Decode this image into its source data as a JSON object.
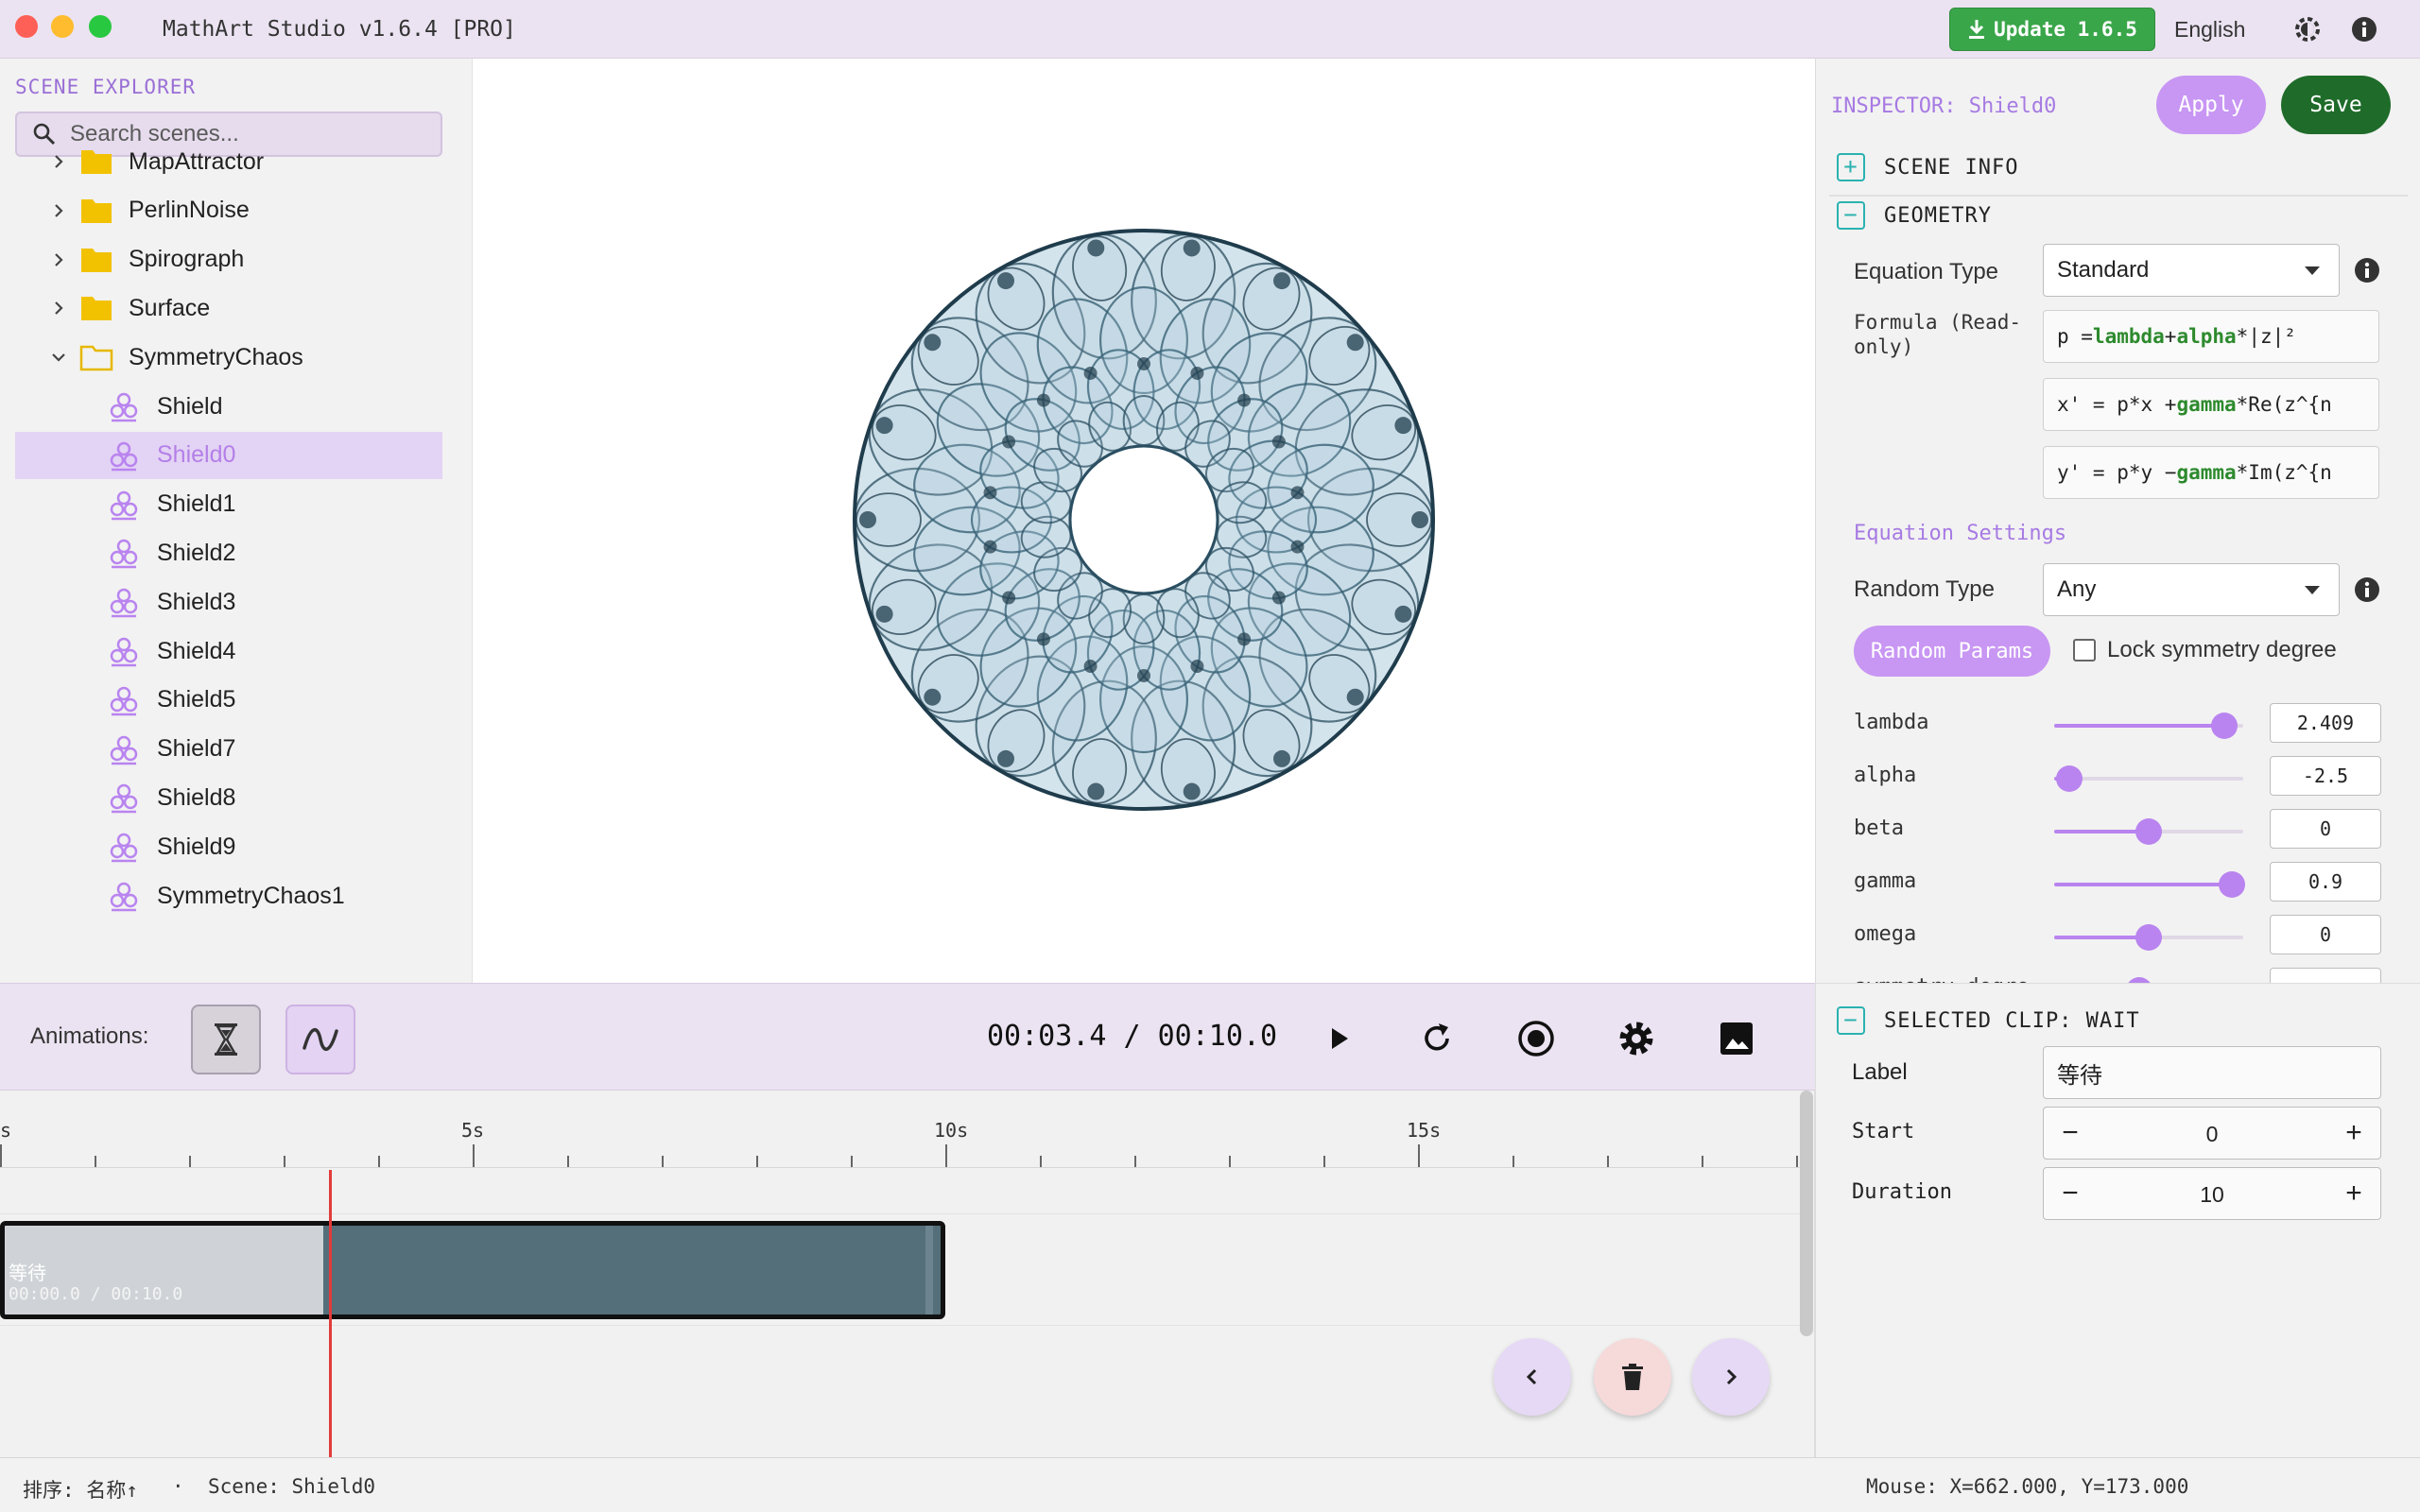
{
  "window": {
    "title": "MathArt Studio v1.6.4 [PRO]",
    "update_label": "Update 1.6.5",
    "language": "English"
  },
  "explorer": {
    "title": "SCENE EXPLORER",
    "search_placeholder": "Search scenes...",
    "folders": [
      {
        "label": "MapAttractor",
        "expanded": false
      },
      {
        "label": "PerlinNoise",
        "expanded": false
      },
      {
        "label": "Spirograph",
        "expanded": false
      },
      {
        "label": "Surface",
        "expanded": false
      },
      {
        "label": "SymmetryChaos",
        "expanded": true
      }
    ],
    "scenes": [
      "Shield",
      "Shield0",
      "Shield1",
      "Shield2",
      "Shield3",
      "Shield4",
      "Shield5",
      "Shield7",
      "Shield8",
      "Shield9",
      "SymmetryChaos1"
    ],
    "selected": "Shield0"
  },
  "inspector": {
    "title": "INSPECTOR: Shield0",
    "apply_label": "Apply",
    "save_label": "Save",
    "scene_info_label": "SCENE INFO",
    "geometry_label": "GEOMETRY",
    "equation_type_label": "Equation Type",
    "equation_type_value": "Standard",
    "formula_label": "Formula (Read-only)",
    "formula_lines": [
      {
        "pre": "p = ",
        "k1": "lambda",
        "mid": " + ",
        "k2": "alpha",
        "post": "*|z|²"
      },
      {
        "pre": "x' = p*x + ",
        "k1": "gamma",
        "mid": "*Re(z^{n",
        "k2": "",
        "post": ""
      },
      {
        "pre": "y' = p*y − ",
        "k1": "gamma",
        "mid": "*Im(z^{n",
        "k2": "",
        "post": ""
      }
    ],
    "equation_settings_label": "Equation Settings",
    "random_type_label": "Random Type",
    "random_type_value": "Any",
    "random_params_label": "Random Params",
    "lock_symmetry_label": "Lock symmetry degree",
    "lock_symmetry_checked": false,
    "params": [
      {
        "name": "lambda",
        "value": "2.409",
        "slider": 0.9
      },
      {
        "name": "alpha",
        "value": "-2.5",
        "slider": 0.08
      },
      {
        "name": "beta",
        "value": "0",
        "slider": 0.5
      },
      {
        "name": "gamma",
        "value": "0.9",
        "slider": 0.94
      },
      {
        "name": "omega",
        "value": "0",
        "slider": 0.5
      },
      {
        "name": "symmetry_degre",
        "value": "",
        "slider": 0.45
      }
    ]
  },
  "animation": {
    "label": "Animations:",
    "current_time": "00:03.4",
    "total_time": "00:10.0",
    "time_readout": "00:03.4 / 00:10.0",
    "ruler_labels": [
      "s",
      "5s",
      "10s",
      "15s"
    ],
    "clip": {
      "name": "等待",
      "time": "00:00.0 / 00:10.0",
      "progress": 0.34
    }
  },
  "selected_clip": {
    "title": "SELECTED CLIP: WAIT",
    "label_label": "Label",
    "label_value": "等待",
    "start_label": "Start",
    "start_value": "0",
    "duration_label": "Duration",
    "duration_value": "10"
  },
  "status": {
    "sort": "排序: 名称↑",
    "dot": "·",
    "scene": "Scene: Shield0",
    "mouse": "Mouse: X=662.000, Y=173.000"
  },
  "icons": {
    "update": "download-icon",
    "theme": "gear-theme-icon",
    "info": "info-icon",
    "search": "search-icon",
    "folder": "folder-icon",
    "scene": "symmetry-scene-icon",
    "play": "play-icon",
    "restart": "refresh-icon",
    "record": "record-icon",
    "settings": "gear-icon",
    "export": "image-icon",
    "prev": "chevron-left-icon",
    "delete": "trash-icon",
    "next": "chevron-right-icon"
  },
  "colors": {
    "accent": "#b984ef",
    "save": "#1f6b2a",
    "update": "#3aa64a",
    "playhead": "#e23b3b",
    "clip": "#546e7a"
  }
}
